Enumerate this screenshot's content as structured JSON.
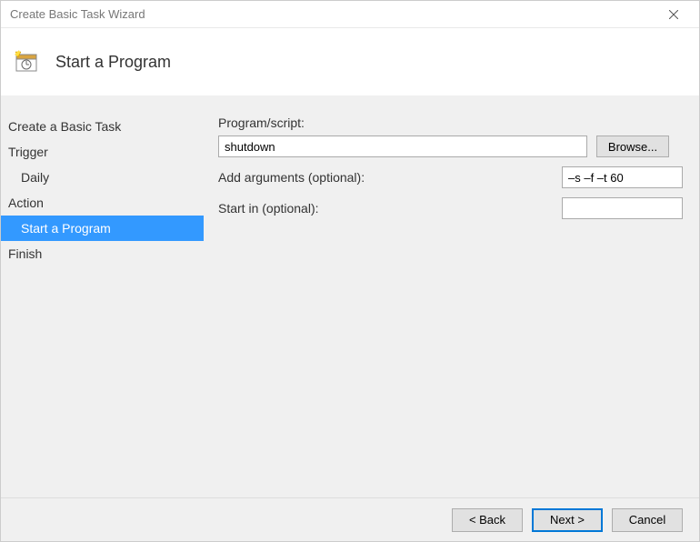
{
  "window": {
    "title": "Create Basic Task Wizard"
  },
  "header": {
    "title": "Start a Program"
  },
  "sidebar": {
    "items": [
      {
        "label": "Create a Basic Task",
        "indent": false,
        "selected": false
      },
      {
        "label": "Trigger",
        "indent": false,
        "selected": false
      },
      {
        "label": "Daily",
        "indent": true,
        "selected": false
      },
      {
        "label": "Action",
        "indent": false,
        "selected": false
      },
      {
        "label": "Start a Program",
        "indent": true,
        "selected": true
      },
      {
        "label": "Finish",
        "indent": false,
        "selected": false
      }
    ]
  },
  "form": {
    "program_label": "Program/script:",
    "program_value": "shutdown",
    "browse_label": "Browse...",
    "arguments_label": "Add arguments (optional):",
    "arguments_value": "–s –f –t 60",
    "startin_label": "Start in (optional):",
    "startin_value": ""
  },
  "footer": {
    "back": "< Back",
    "next": "Next >",
    "cancel": "Cancel"
  }
}
